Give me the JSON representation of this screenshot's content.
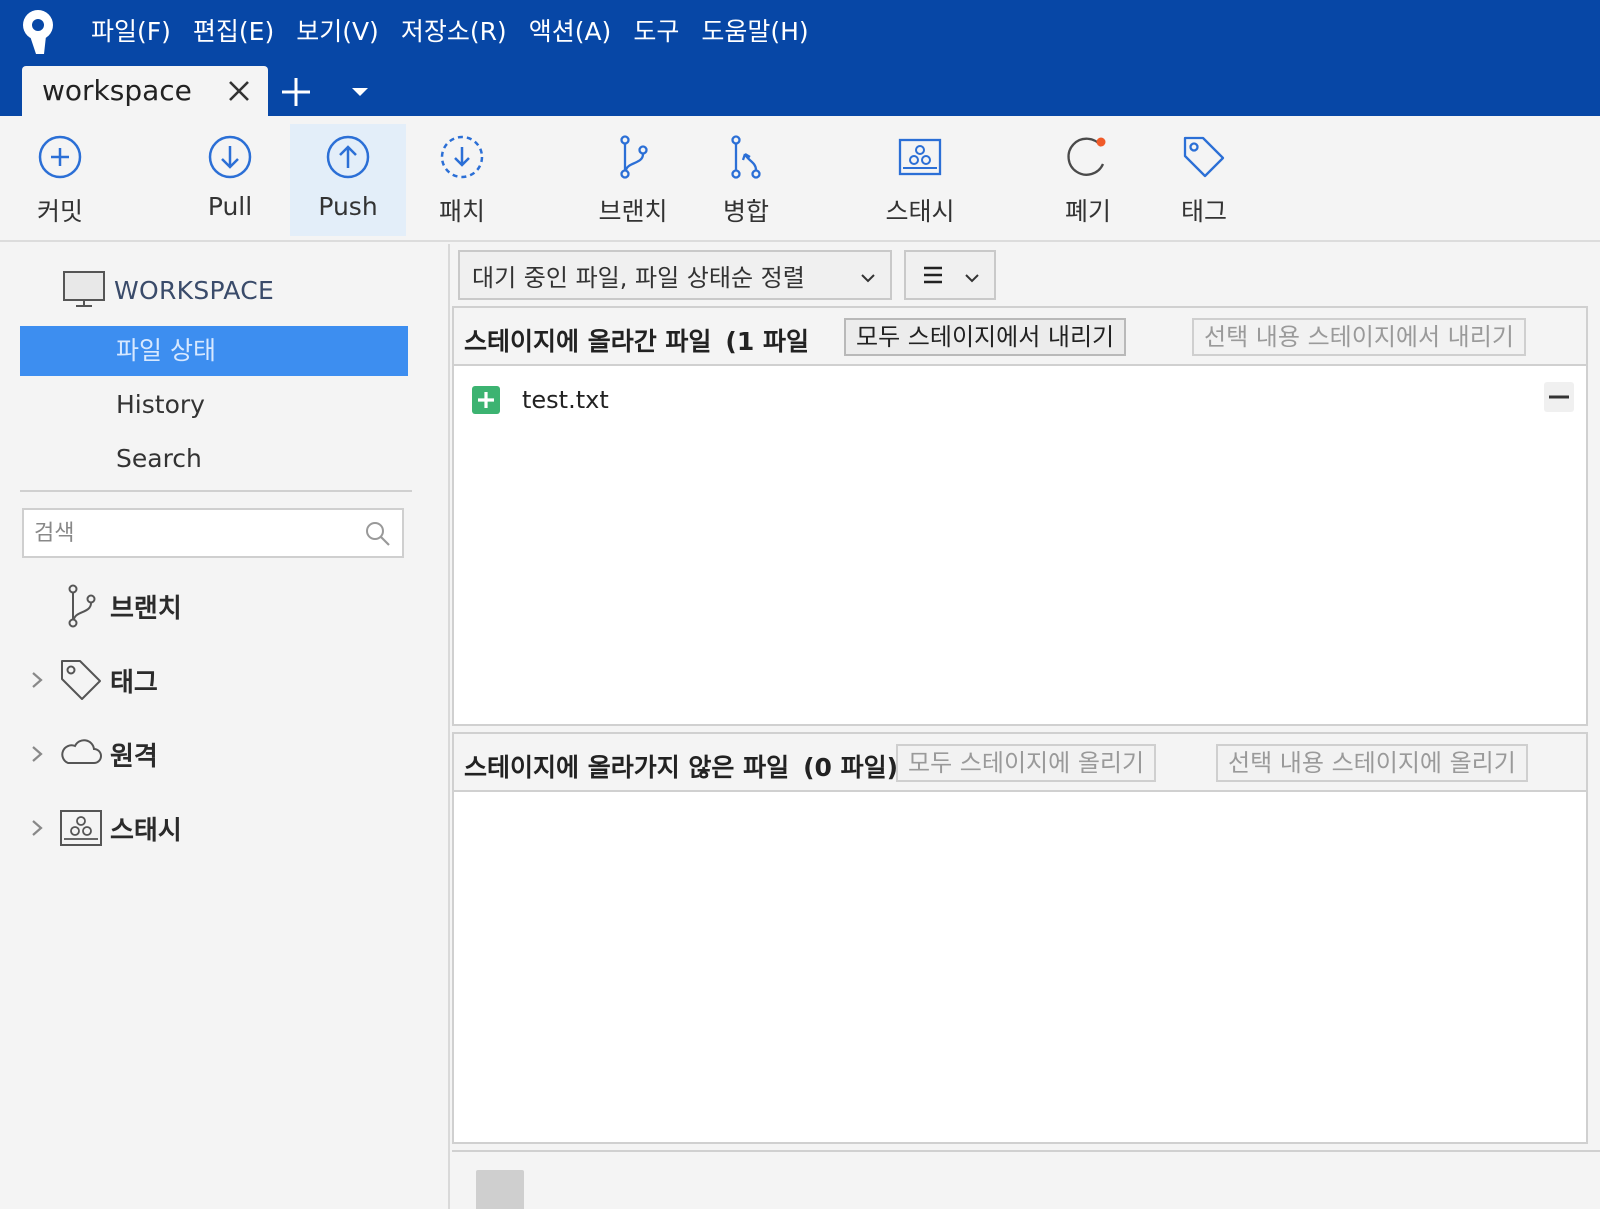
{
  "app": {
    "menu": [
      "파일(F)",
      "편집(E)",
      "보기(V)",
      "저장소(R)",
      "액션(A)",
      "도구",
      "도움말(H)"
    ],
    "tab": {
      "label": "workspace"
    }
  },
  "toolbar": {
    "commit": "커밋",
    "pull": "Pull",
    "push": "Push",
    "patch": "패치",
    "branch": "브랜치",
    "merge": "병합",
    "stash": "스태시",
    "discard": "폐기",
    "tag": "태그"
  },
  "sidebar": {
    "workspace_title": "WORKSPACE",
    "nav": [
      "파일 상태",
      "History",
      "Search"
    ],
    "search_placeholder": "검색",
    "sections": {
      "branches": "브랜치",
      "tags": "태그",
      "remotes": "원격",
      "stashes": "스태시"
    }
  },
  "main": {
    "sort_label": "대기 중인 파일, 파일 상태순 정렬",
    "staged": {
      "title": "스테이지에 올라간 파일",
      "count": "(1 파일",
      "unstage_all": "모두 스테이지에서 내리기",
      "unstage_selected": "선택 내용 스테이지에서 내리기",
      "files": [
        "test.txt"
      ]
    },
    "unstaged": {
      "title": "스테이지에 올라가지 않은 파일",
      "count": "(0 파일)",
      "stage_all": "모두 스테이지에 올리기",
      "stage_selected": "선택 내용 스테이지에 올리기"
    }
  },
  "colors": {
    "titlebar": "#0747a6",
    "selection": "#3d8ef0",
    "accent_icon": "#2b6fd6",
    "added": "#3cb371",
    "notify_dot": "#f05a28"
  }
}
